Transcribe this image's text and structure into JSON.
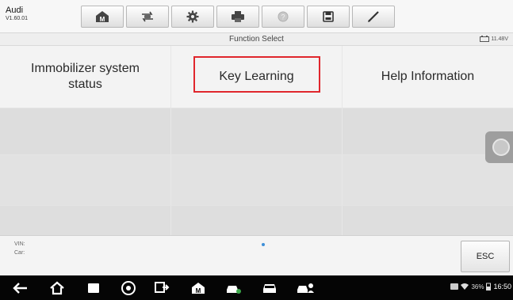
{
  "app": {
    "name": "Audi",
    "version": "V1.60.01"
  },
  "toolbar": {
    "buttons": [
      {
        "icon": "home-icon"
      },
      {
        "icon": "vehicle-swap-icon"
      },
      {
        "icon": "settings-icon"
      },
      {
        "icon": "print-icon"
      },
      {
        "icon": "help-icon"
      },
      {
        "icon": "save-icon"
      },
      {
        "icon": "edit-icon"
      }
    ]
  },
  "header": {
    "title": "Function Select",
    "battery_voltage": "11.48V"
  },
  "functions": [
    {
      "label": "Immobilizer system status"
    },
    {
      "label": "Key Learning",
      "highlighted": true
    },
    {
      "label": "Help Information"
    }
  ],
  "vehicle_info": {
    "vin_label": "VIN:",
    "car_label": "Car:"
  },
  "esc_button": {
    "label": "ESC"
  },
  "system_bar": {
    "battery_percent": "36%",
    "time": "16:50"
  },
  "colors": {
    "highlight_border": "#e0262c",
    "page_indicator": "#3e8fd8",
    "navbar_bg": "#050505"
  }
}
